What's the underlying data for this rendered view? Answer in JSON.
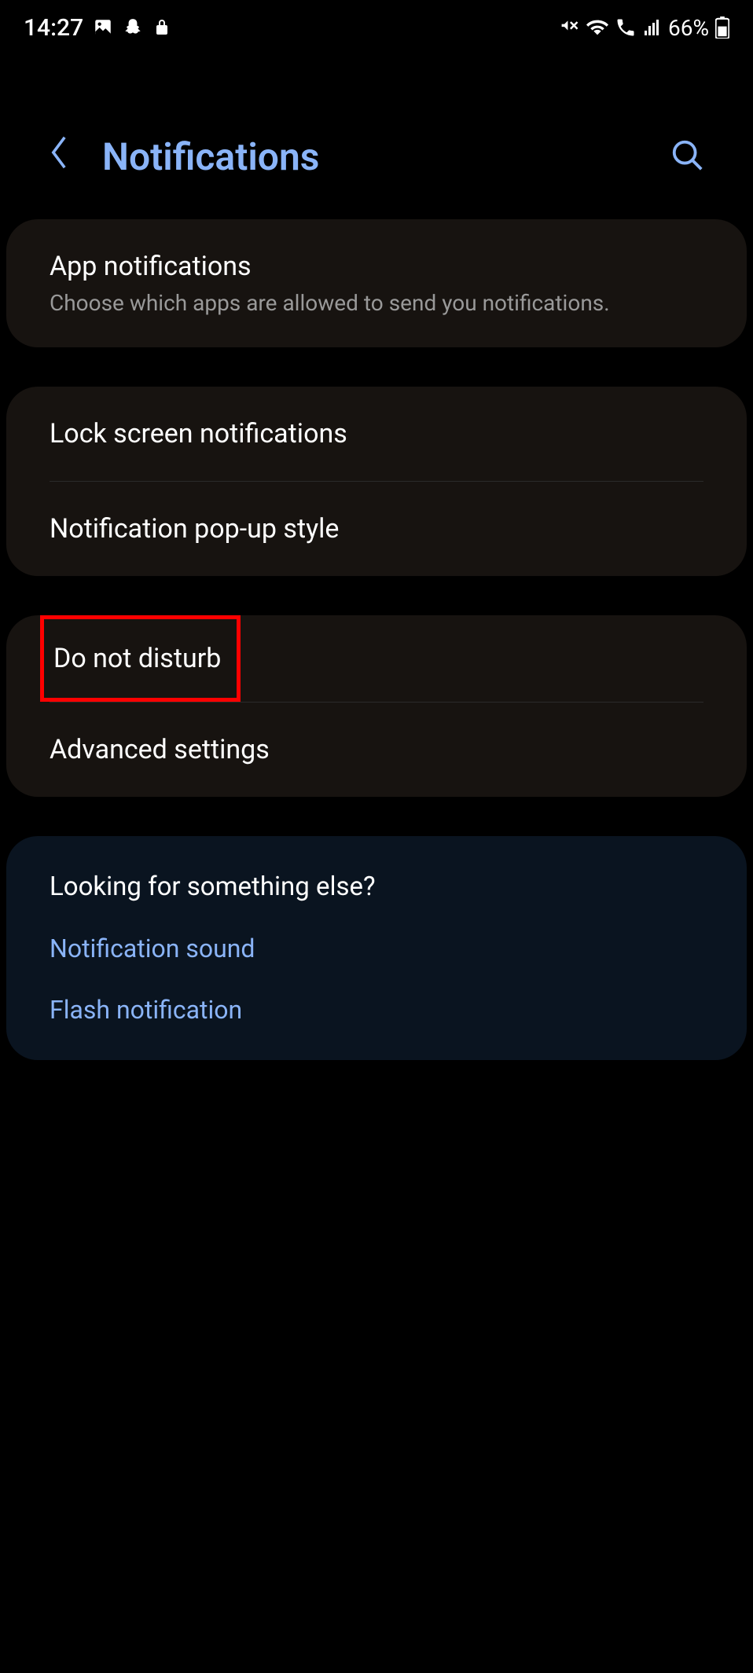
{
  "status_bar": {
    "time": "14:27",
    "battery": "66%"
  },
  "header": {
    "title": "Notifications"
  },
  "cards": {
    "app_notifications": {
      "title": "App notifications",
      "subtitle": "Choose which apps are allowed to send you notifications."
    },
    "lock_screen": {
      "title": "Lock screen notifications"
    },
    "popup_style": {
      "title": "Notification pop-up style"
    },
    "dnd": {
      "title": "Do not disturb"
    },
    "advanced": {
      "title": "Advanced settings"
    }
  },
  "footer": {
    "heading": "Looking for something else?",
    "links": {
      "sound": "Notification sound",
      "flash": "Flash notification"
    }
  }
}
